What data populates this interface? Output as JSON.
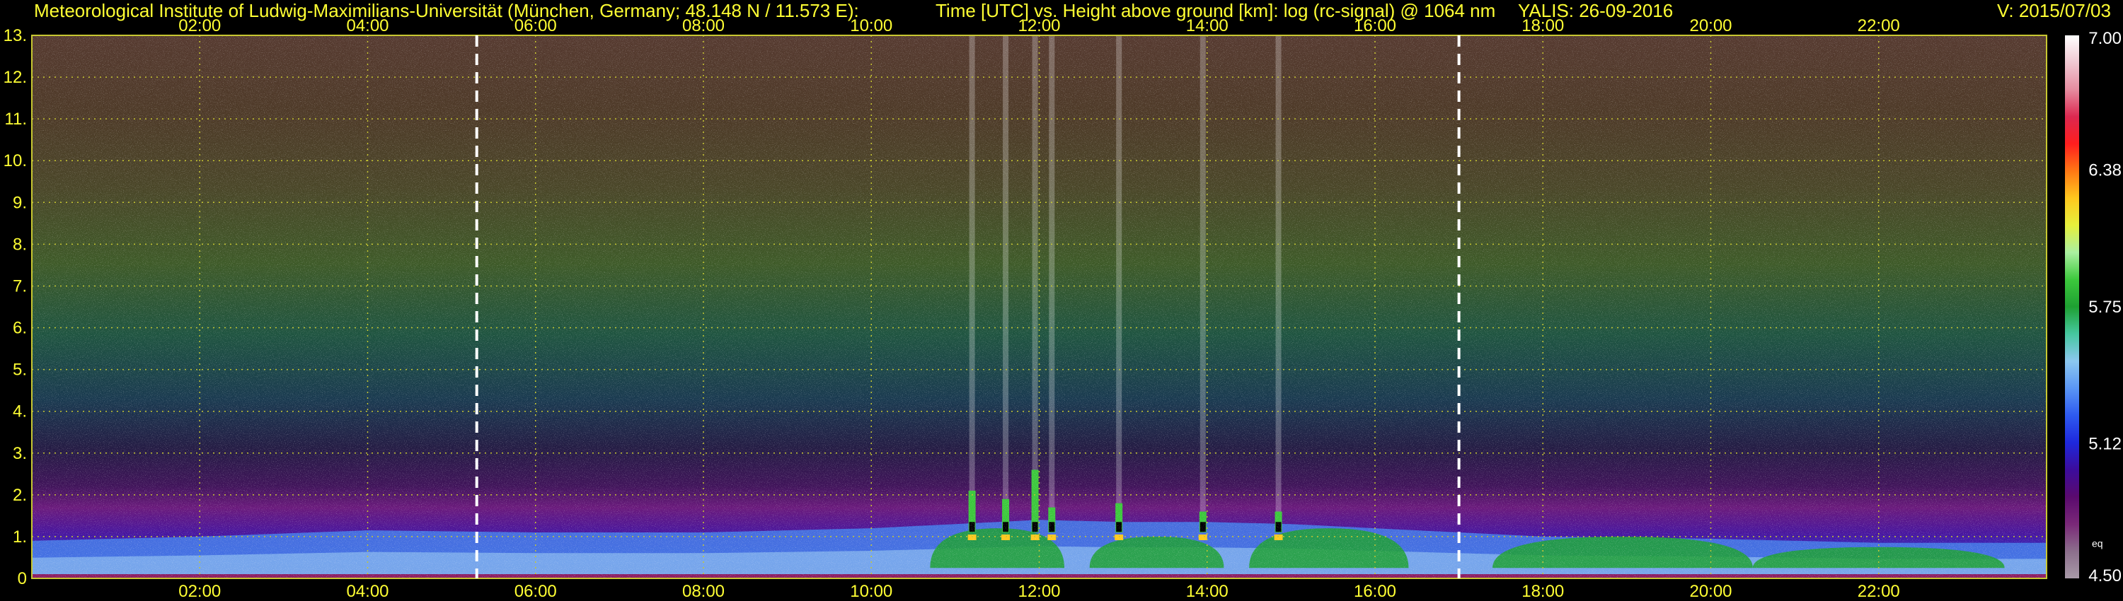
{
  "header": {
    "institute": "Meteorological Institute of Ludwig-Maximilians-Universität (München, Germany; 48.148 N / 11.573 E):",
    "axes_desc": "Time [UTC] vs. Height above ground [km]: log (rc-signal) @ 1064 nm",
    "instrument": "YALIS: 26-09-2016",
    "version": "V: 2015/07/03"
  },
  "colors": {
    "background": "#000000",
    "text": "#ffff33",
    "grid": "#c8c832",
    "marker_line": "#ffffff"
  },
  "chart_data": {
    "type": "heatmap",
    "title": "log (rc-signal) @ 1064 nm",
    "xlabel": "Time [UTC]",
    "ylabel": "Height above ground [km]",
    "xlim_hours": [
      0,
      24
    ],
    "ylim": [
      0,
      13
    ],
    "x_ticks": [
      "02:00",
      "04:00",
      "06:00",
      "08:00",
      "10:00",
      "12:00",
      "14:00",
      "16:00",
      "18:00",
      "20:00",
      "22:00"
    ],
    "x_tick_hours": [
      2,
      4,
      6,
      8,
      10,
      12,
      14,
      16,
      18,
      20,
      22
    ],
    "y_ticks": [
      "0",
      "1.",
      "2.",
      "3.",
      "4.",
      "5.",
      "6.",
      "7.",
      "8.",
      "9.",
      "10.",
      "11.",
      "12.",
      "13."
    ],
    "y_tick_values": [
      0,
      1,
      2,
      3,
      4,
      5,
      6,
      7,
      8,
      9,
      10,
      11,
      12,
      13
    ],
    "grid": true,
    "marker_lines_hours": [
      5.3,
      17.0
    ],
    "colorbar": {
      "min": 4.5,
      "max": 7.0,
      "tick_labels": [
        "7.00",
        "6.38",
        "5.75",
        "5.12",
        "4.50"
      ],
      "tick_values": [
        7.0,
        6.38,
        5.75,
        5.12,
        4.5
      ],
      "extra_label": "eq",
      "colors": [
        "#a89aa8",
        "#8c6e8c",
        "#7a2878",
        "#5a0a6e",
        "#3c0c9c",
        "#1e28dc",
        "#2e5af0",
        "#5a96f5",
        "#8cc8f0",
        "#46c8a0",
        "#1ea032",
        "#3cc83c",
        "#aaf0a0",
        "#e6f03c",
        "#ffc81e",
        "#ff7814",
        "#ff1e1e",
        "#dc2850",
        "#e68ca0",
        "#f0c8d2",
        "#ffffff"
      ]
    },
    "boundary_layer_top_km": [
      {
        "hour": 0,
        "km": 0.9
      },
      {
        "hour": 2,
        "km": 1.0
      },
      {
        "hour": 4,
        "km": 1.15
      },
      {
        "hour": 6,
        "km": 1.1
      },
      {
        "hour": 8,
        "km": 1.1
      },
      {
        "hour": 10,
        "km": 1.2
      },
      {
        "hour": 11,
        "km": 1.3
      },
      {
        "hour": 12,
        "km": 1.4
      },
      {
        "hour": 13,
        "km": 1.35
      },
      {
        "hour": 14,
        "km": 1.35
      },
      {
        "hour": 15,
        "km": 1.3
      },
      {
        "hour": 16,
        "km": 1.2
      },
      {
        "hour": 18,
        "km": 1.0
      },
      {
        "hour": 20,
        "km": 0.95
      },
      {
        "hour": 22,
        "km": 0.85
      },
      {
        "hour": 24,
        "km": 0.85
      }
    ],
    "cloud_plumes": [
      {
        "hour": 11.2,
        "top_km": 2.1
      },
      {
        "hour": 11.6,
        "top_km": 1.9
      },
      {
        "hour": 11.95,
        "top_km": 2.6
      },
      {
        "hour": 12.15,
        "top_km": 1.7
      },
      {
        "hour": 12.95,
        "top_km": 1.8
      },
      {
        "hour": 13.95,
        "top_km": 1.6
      },
      {
        "hour": 14.85,
        "top_km": 1.6
      }
    ]
  }
}
